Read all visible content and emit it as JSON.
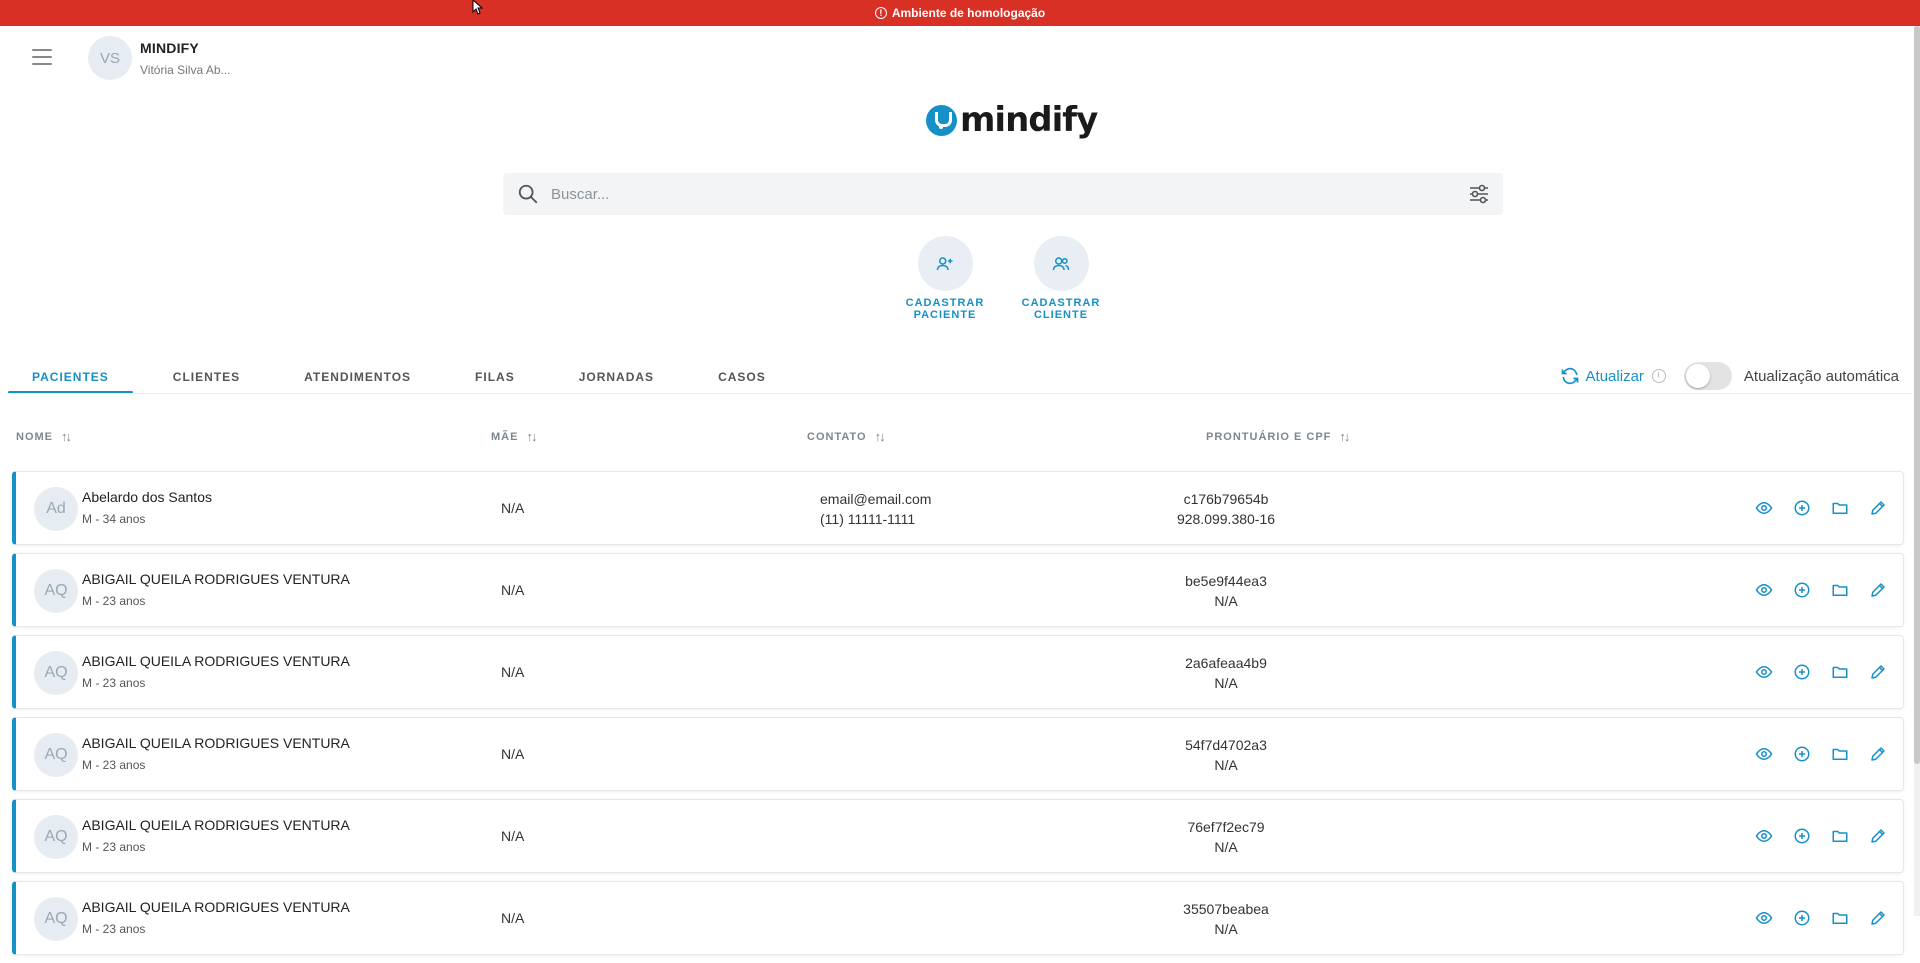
{
  "banner": {
    "text": "Ambiente de homologação"
  },
  "account": {
    "initials": "VS",
    "org": "MINDIFY",
    "user": "Vitória Silva Ab..."
  },
  "logo": {
    "text": "mindify"
  },
  "search": {
    "placeholder": "Buscar..."
  },
  "quick_actions": [
    {
      "label": "CADASTRAR PACIENTE",
      "icon": "add-user-icon"
    },
    {
      "label": "CADASTRAR CLIENTE",
      "icon": "users-icon"
    }
  ],
  "tabs": [
    {
      "label": "PACIENTES",
      "active": true
    },
    {
      "label": "CLIENTES",
      "active": false
    },
    {
      "label": "ATENDIMENTOS",
      "active": false
    },
    {
      "label": "FILAS",
      "active": false
    },
    {
      "label": "JORNADAS",
      "active": false
    },
    {
      "label": "CASOS",
      "active": false
    }
  ],
  "refresh": {
    "label": "Atualizar",
    "auto_label": "Atualização automática",
    "auto_enabled": false
  },
  "columns": {
    "name": "NOME",
    "mother": "MÃE",
    "contact": "CONTATO",
    "record": "PRONTUÁRIO E CPF"
  },
  "patients": [
    {
      "initials": "Ad",
      "name": "Abelardo dos Santos",
      "sub": "M - 34 anos",
      "mother": "N/A",
      "email": "email@email.com",
      "phone": "(11) 11111-1111",
      "record": "c176b79654b",
      "cpf": "928.099.380-16"
    },
    {
      "initials": "AQ",
      "name": "ABIGAIL QUEILA RODRIGUES VENTURA",
      "sub": "M - 23 anos",
      "mother": "N/A",
      "email": "",
      "phone": "",
      "record": "be5e9f44ea3",
      "cpf": "N/A"
    },
    {
      "initials": "AQ",
      "name": "ABIGAIL QUEILA RODRIGUES VENTURA",
      "sub": "M - 23 anos",
      "mother": "N/A",
      "email": "",
      "phone": "",
      "record": "2a6afeaa4b9",
      "cpf": "N/A"
    },
    {
      "initials": "AQ",
      "name": "ABIGAIL QUEILA RODRIGUES VENTURA",
      "sub": "M - 23 anos",
      "mother": "N/A",
      "email": "",
      "phone": "",
      "record": "54f7d4702a3",
      "cpf": "N/A"
    },
    {
      "initials": "AQ",
      "name": "ABIGAIL QUEILA RODRIGUES VENTURA",
      "sub": "M - 23 anos",
      "mother": "N/A",
      "email": "",
      "phone": "",
      "record": "76ef7f2ec79",
      "cpf": "N/A"
    },
    {
      "initials": "AQ",
      "name": "ABIGAIL QUEILA RODRIGUES VENTURA",
      "sub": "M - 23 anos",
      "mother": "N/A",
      "email": "",
      "phone": "",
      "record": "35507beabea",
      "cpf": "N/A"
    }
  ],
  "colors": {
    "banner": "#d93025",
    "accent": "#1590c8"
  }
}
